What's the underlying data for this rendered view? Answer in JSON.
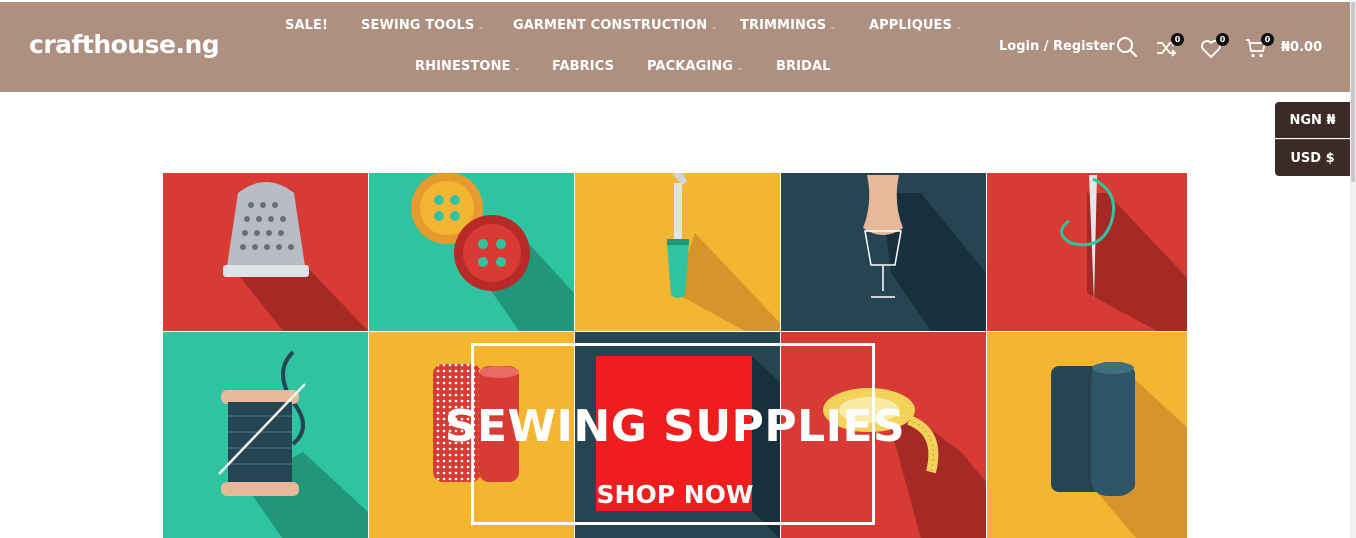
{
  "brand": {
    "logo": "crafthouse.ng"
  },
  "nav": {
    "row1": [
      {
        "label": "SALE!",
        "has_dropdown": false
      },
      {
        "label": "SEWING TOOLS",
        "has_dropdown": true
      },
      {
        "label": "GARMENT CONSTRUCTION",
        "has_dropdown": true
      },
      {
        "label": "TRIMMINGS",
        "has_dropdown": true
      },
      {
        "label": "APPLIQUES",
        "has_dropdown": true
      }
    ],
    "row2": [
      {
        "label": "RHINESTONE",
        "has_dropdown": true
      },
      {
        "label": "FABRICS",
        "has_dropdown": false
      },
      {
        "label": "PACKAGING",
        "has_dropdown": true
      },
      {
        "label": "BRIDAL",
        "has_dropdown": false
      }
    ],
    "dropdown_glyph": "⌄"
  },
  "header_tools": {
    "login_label": "Login / Register",
    "compare_count": "0",
    "wishlist_count": "0",
    "cart_count": "0",
    "cart_total": "₦0.00"
  },
  "currency_switcher": {
    "options": [
      "NGN ₦",
      "USD $"
    ]
  },
  "banner": {
    "title": "SEWING SUPPLIES",
    "cta": "SHOP NOW",
    "tile_colors": [
      "#d83a34",
      "#2ec4a0",
      "#f2b631",
      "#264553",
      "#d83a34",
      "#2ec4a0",
      "#f2b631",
      "#264553",
      "#d83a34",
      "#f2b631"
    ],
    "icons": [
      "thimble-icon",
      "buttons-icon",
      "seam-ripper-icon",
      "dress-form-icon",
      "needle-thread-icon",
      "thread-spool-icon",
      "fabric-roll-icon",
      "sale-square-icon",
      "measuring-tape-icon",
      "fabric-bolt-icon"
    ]
  },
  "colors": {
    "header_bg": "#ad9080",
    "currency_bg": "#3b2a25",
    "badge_bg": "#111111"
  }
}
